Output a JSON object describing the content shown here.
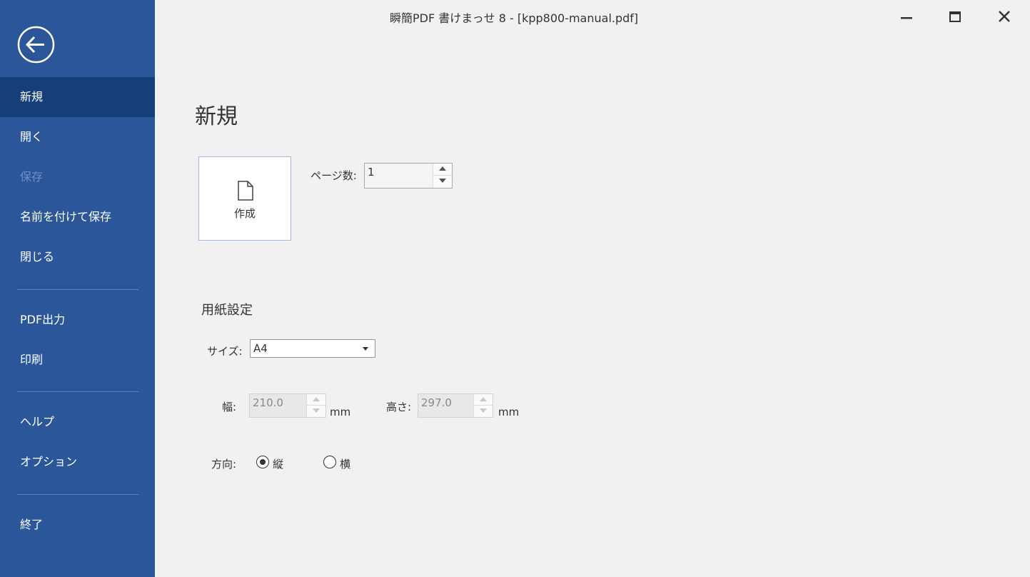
{
  "window": {
    "title": "瞬簡PDF 書けまっせ 8 - [kpp800-manual.pdf]",
    "controls": [
      "minimize-icon",
      "maximize-icon",
      "close-icon"
    ]
  },
  "sidebar": {
    "back_icon": "back-arrow-icon",
    "items": [
      {
        "label": "新規",
        "state": "active"
      },
      {
        "label": "開く"
      },
      {
        "label": "保存",
        "state": "disabled"
      },
      {
        "label": "名前を付けて保存"
      },
      {
        "label": "閉じる"
      },
      {
        "label": "PDF出力"
      },
      {
        "label": "印刷"
      },
      {
        "label": "ヘルプ"
      },
      {
        "label": "オプション"
      },
      {
        "label": "終了"
      }
    ]
  },
  "main": {
    "title": "新規",
    "create_tile": {
      "label": "作成",
      "icon": "document-icon"
    },
    "page_count": {
      "label": "ページ数:",
      "value": "1"
    },
    "paper": {
      "heading": "用紙設定",
      "size_label": "サイズ:",
      "size_value": "A4",
      "width_label": "幅:",
      "width_value": "210.0",
      "width_unit": "mm",
      "height_label": "高さ:",
      "height_value": "297.0",
      "height_unit": "mm",
      "orientation_label": "方向:",
      "orientation_options": [
        {
          "label": "縦",
          "selected": true
        },
        {
          "label": "横",
          "selected": false
        }
      ]
    }
  },
  "colors": {
    "sidebar_bg": "#2b579a",
    "sidebar_active": "#163f7a",
    "content_bg": "#f1f1f1"
  }
}
